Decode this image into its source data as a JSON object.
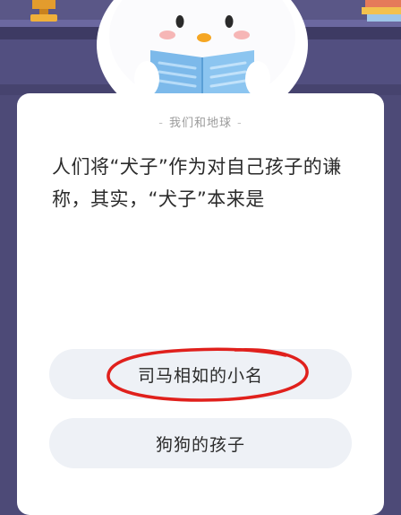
{
  "quiz": {
    "category": "我们和地球",
    "category_dash_left": "-",
    "category_dash_right": "-",
    "question": "人们将“犬子”作为对自己孩子的谦称，其实，“犬子”本来是",
    "options": [
      {
        "label": "司马相如的小名"
      },
      {
        "label": "狗狗的孩子"
      }
    ]
  },
  "colors": {
    "background": "#4d4a77",
    "card": "#ffffff",
    "option_bg": "#eef1f6",
    "annotation": "#e0201c"
  },
  "icons": [
    "trophy-icon",
    "books-icon",
    "penguin-mascot",
    "open-book-icon",
    "red-circle-annotation"
  ]
}
